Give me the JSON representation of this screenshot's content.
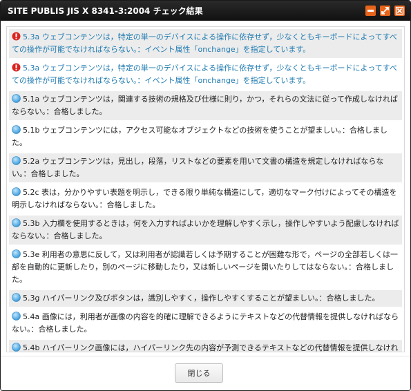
{
  "window": {
    "title": "SITE PUBLIS JIS X 8341-3:2004 チェック結果",
    "accent_color": "#e8641b"
  },
  "results": [
    {
      "status": "error",
      "icon": "error-icon",
      "code": "5.3a",
      "text": "ウェブコンテンツは，特定の単一のデバイスによる操作に依存せず，少なくともキーボードによってすべての操作が可能でなければならない。：イベント属性「onchange」を指定しています。"
    },
    {
      "status": "error",
      "icon": "error-icon",
      "code": "5.3a",
      "text": "ウェブコンテンツは，特定の単一のデバイスによる操作に依存せず，少なくともキーボードによってすべての操作が可能でなければならない。：イベント属性「onchange」を指定しています。"
    },
    {
      "status": "pass",
      "icon": "pass-icon",
      "code": "5.1a",
      "text": "ウェブコンテンツは，関連する技術の規格及び仕様に則り，かつ，それらの文法に従って作成しなければならない。：合格しました。"
    },
    {
      "status": "pass",
      "icon": "pass-icon",
      "code": "5.1b",
      "text": "ウェブコンテンツには，アクセス可能なオブジェクトなどの技術を使うことが望ましい。：合格しました。"
    },
    {
      "status": "pass",
      "icon": "pass-icon",
      "code": "5.2a",
      "text": "ウェブコンテンツは，見出し，段落，リストなどの要素を用いて文書の構造を規定しなければならない。：合格しました。"
    },
    {
      "status": "pass",
      "icon": "pass-icon",
      "code": "5.2c",
      "text": "表は，分かりやすい表題を明示し，できる限り単純な構造にして，適切なマーク付けによってその構造を明示しなければならない。：合格しました。"
    },
    {
      "status": "pass",
      "icon": "pass-icon",
      "code": "5.3b",
      "text": "入力欄を使用するときは，何を入力すればよいかを理解しやすく示し，操作しやすいよう配慮しなければならない。：合格しました。"
    },
    {
      "status": "pass",
      "icon": "pass-icon",
      "code": "5.3e",
      "text": "利用者の意思に反して，又は利用者が認識若しくは予期することが困難な形で，ページの全部若しくは一部を自動的に更新したり，別のページに移動したり，又は新しいページを開いたりしてはならない。：合格しました。"
    },
    {
      "status": "pass",
      "icon": "pass-icon",
      "code": "5.3g",
      "text": "ハイパーリンク及びボタンは，識別しやすく，操作しやすくすることが望ましい。：合格しました。"
    },
    {
      "status": "pass",
      "icon": "pass-icon",
      "code": "5.4a",
      "text": "画像には，利用者が画像の内容を的確に理解できるようにテキストなどの代替情報を提供しなければならない。：合格しました。"
    },
    {
      "status": "pass",
      "icon": "pass-icon",
      "code": "5.4b",
      "text": "ハイパーリンク画像には，ハイパーリンク先の内容が予測できるテキストなどの代替情報を提供しなければならない。：合格しました。"
    }
  ],
  "footer": {
    "close_label": "閉じる"
  },
  "colors": {
    "error_text": "#1e7ab0",
    "pass_icon": "#3a9ad9",
    "error_icon": "#d9241f",
    "row_alt": "#ececec"
  }
}
